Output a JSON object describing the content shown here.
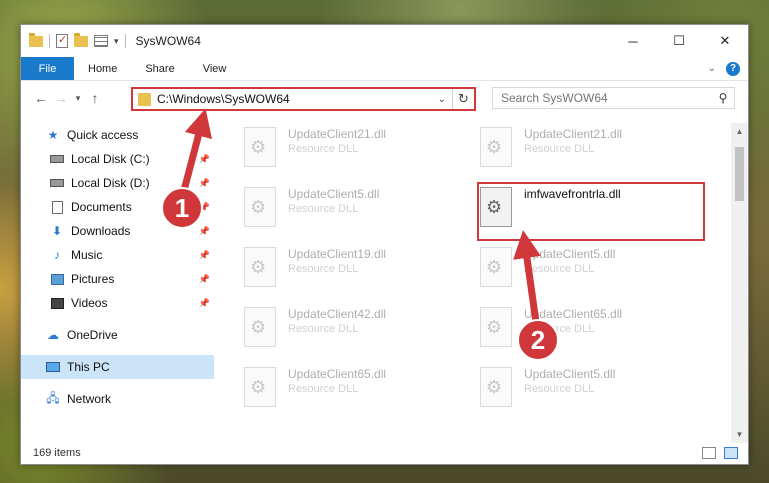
{
  "window": {
    "title": "SysWOW64",
    "controls": {
      "minimize": "─",
      "maximize": "☐",
      "close": "✕"
    }
  },
  "ribbon": {
    "tabs": [
      {
        "label": "File"
      },
      {
        "label": "Home"
      },
      {
        "label": "Share"
      },
      {
        "label": "View"
      }
    ],
    "expand_icon": "chevron-down-icon",
    "help_label": "?"
  },
  "navigation": {
    "back_glyph": "←",
    "forward_glyph": "→",
    "recent_glyph": "▾",
    "up_glyph": "↑",
    "address_path": "C:\\Windows\\SysWOW64",
    "refresh_glyph": "↻",
    "search_placeholder": "Search SysWOW64"
  },
  "sidebar": {
    "items": [
      {
        "label": "Quick access",
        "icon": "star-icon"
      },
      {
        "label": "Local Disk (C:)",
        "icon": "disk-icon",
        "pinned": true
      },
      {
        "label": "Local Disk (D:)",
        "icon": "disk-icon",
        "pinned": true
      },
      {
        "label": "Documents",
        "icon": "documents-icon",
        "pinned": true
      },
      {
        "label": "Downloads",
        "icon": "downloads-icon",
        "pinned": true
      },
      {
        "label": "Music",
        "icon": "music-icon",
        "pinned": true
      },
      {
        "label": "Pictures",
        "icon": "pictures-icon",
        "pinned": true
      },
      {
        "label": "Videos",
        "icon": "videos-icon",
        "pinned": true
      },
      {
        "label": "OneDrive",
        "icon": "cloud-icon"
      },
      {
        "label": "This PC",
        "icon": "pc-icon",
        "selected": true
      },
      {
        "label": "Network",
        "icon": "network-icon"
      }
    ]
  },
  "files": [
    {
      "name": "UpdateClient21.dll",
      "type": "Resource DLL"
    },
    {
      "name": "UpdateClient21.dll",
      "type": "Resource DLL"
    },
    {
      "name": "UpdateClient5.dll",
      "type": "Resource DLL"
    },
    {
      "name": "imfwavefrontrla.dll",
      "type": "",
      "highlighted": true
    },
    {
      "name": "UpdateClient19.dll",
      "type": "Resource DLL"
    },
    {
      "name": "UpdateClient5.dll",
      "type": "Resource DLL"
    },
    {
      "name": "UpdateClient42.dll",
      "type": "Resource DLL"
    },
    {
      "name": "UpdateClient65.dll",
      "type": "Resource DLL"
    },
    {
      "name": "UpdateClient65.dll",
      "type": "Resource DLL"
    },
    {
      "name": "UpdateClient5.dll",
      "type": "Resource DLL"
    }
  ],
  "status": {
    "item_count": "169 items"
  },
  "annotations": {
    "step1": "1",
    "step2": "2",
    "color": "#d0373a"
  }
}
